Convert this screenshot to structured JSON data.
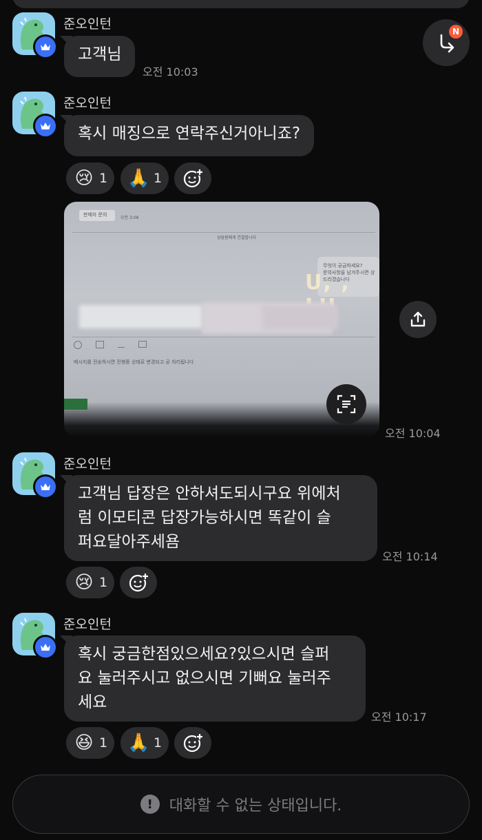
{
  "messages": [
    {
      "sender": "준오인턴",
      "text": "고객님",
      "time": "오전 10:03"
    },
    {
      "sender": "준오인턴",
      "text": "혹시 매징으로 연락주신거아니죠?",
      "reactions": [
        {
          "emoji": "😢",
          "icon": "crying-face-icon",
          "count": "1"
        },
        {
          "emoji": "🙏",
          "icon": "folded-hands-icon",
          "count": "1"
        }
      ]
    },
    {
      "photo": {
        "labels": {
          "header": "판매자 문의",
          "header_time": "오전 3:08",
          "connected": "상담원에게 연결합니다",
          "bubble_line1": "무엇이 궁금하세요?",
          "bubble_line2": "문의사항을 남겨주시면 상",
          "bubble_line3": "드리겠습니다",
          "footer_note": "메시지를 전송하시면 진행중 상태로 변경되고 곧 처리됩니다",
          "glare": "U, , LU"
        }
      },
      "time": "오전 10:04"
    },
    {
      "sender": "준오인턴",
      "lines": [
        "고객님 답장은 안하셔도되시구요 위에처",
        "럼 이모티콘 답장가능하시면 똑같이 슬",
        "퍼요달아주세욤"
      ],
      "time": "오전 10:14",
      "reactions": [
        {
          "emoji": "😢",
          "icon": "crying-face-icon",
          "count": "1"
        }
      ]
    },
    {
      "sender": "준오인턴",
      "lines": [
        "혹시 궁금한점있으세요?있으시면 슬퍼",
        "요 눌러주시고 없으시면 기뻐요 눌러주",
        "세요"
      ],
      "time": "오전 10:17",
      "reactions": [
        {
          "emoji": "😆",
          "icon": "laughing-face-icon",
          "count": "1"
        },
        {
          "emoji": "🙏",
          "icon": "folded-hands-icon",
          "count": "1"
        }
      ]
    }
  ],
  "badge": "N",
  "footer": {
    "icon": "exclamation-icon",
    "text": "대화할 수 없는 상태입니다."
  },
  "colors": {
    "background": "#0b0b0c",
    "bubble": "#2c2c2e",
    "avatar": "#8fd0ee",
    "crown_badge": "#3b6ff5",
    "notification": "#ff5a3c"
  }
}
